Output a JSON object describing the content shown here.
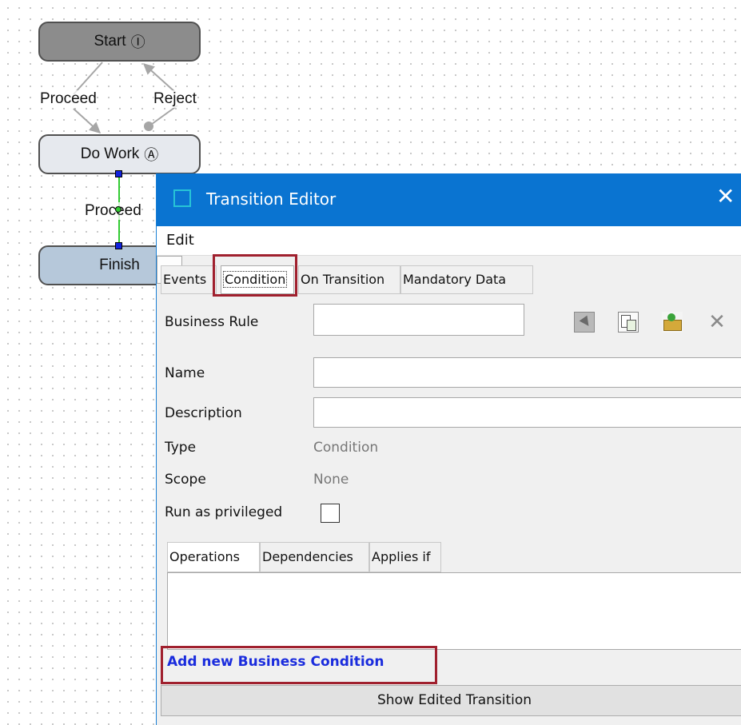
{
  "diagram": {
    "nodes": {
      "start": {
        "label": "Start",
        "marker": "Ⓘ"
      },
      "do_work": {
        "label": "Do Work",
        "marker": "Ⓐ"
      },
      "finish": {
        "label": "Finish"
      }
    },
    "transitions": {
      "start_proceed": "Proceed",
      "start_reject": "Reject",
      "dowork_proceed": "Proceed"
    }
  },
  "dialog": {
    "title": "Transition Editor",
    "close_glyph": "✕",
    "menu": {
      "edit": "Edit"
    },
    "tabs": [
      "Events",
      "Condition",
      "On Transition",
      "Mandatory Data"
    ],
    "selected_tab": "Condition",
    "form": {
      "business_rule_label": "Business Rule",
      "business_rule_value": "",
      "browse_label": "...",
      "name_label": "Name",
      "name_value": "",
      "description_label": "Description",
      "description_value": "",
      "type_label": "Type",
      "type_value": "Condition",
      "scope_label": "Scope",
      "scope_value": "None",
      "run_privileged_label": "Run as privileged",
      "run_privileged_checked": false
    },
    "toolbar_icons": [
      "select-icon",
      "copy-icon",
      "edit-icon",
      "delete-icon"
    ],
    "subtabs": [
      "Operations",
      "Dependencies",
      "Applies if"
    ],
    "selected_subtab": "Operations",
    "add_link": "Add new Business Condition",
    "show_button": "Show Edited Transition"
  },
  "colors": {
    "titlebar": "#0a74d1",
    "highlight": "#a0202e",
    "link": "#1a2cdd",
    "start_node": "#8c8c8c",
    "dowork_node": "#e6e9ee",
    "finish_node": "#b6c8da",
    "selected_connector": "#33cc33"
  }
}
